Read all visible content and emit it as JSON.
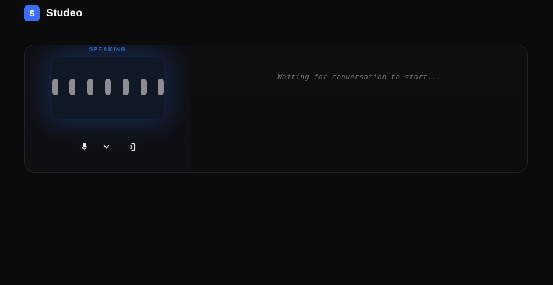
{
  "app": {
    "logo_letter": "S",
    "name": "Studeo",
    "accent_color": "#3b6ef5"
  },
  "agent": {
    "state_label": "SPEAKING",
    "visualizer": {
      "bar_count": 7,
      "bar_color": "#8d8d92",
      "glow_color": "#3f79e6"
    }
  },
  "controls": [
    {
      "name": "microphone-icon"
    },
    {
      "name": "chevron-down-icon"
    },
    {
      "name": "exit-icon"
    }
  ],
  "transcript": {
    "placeholder": "Waiting for conversation to start..."
  }
}
